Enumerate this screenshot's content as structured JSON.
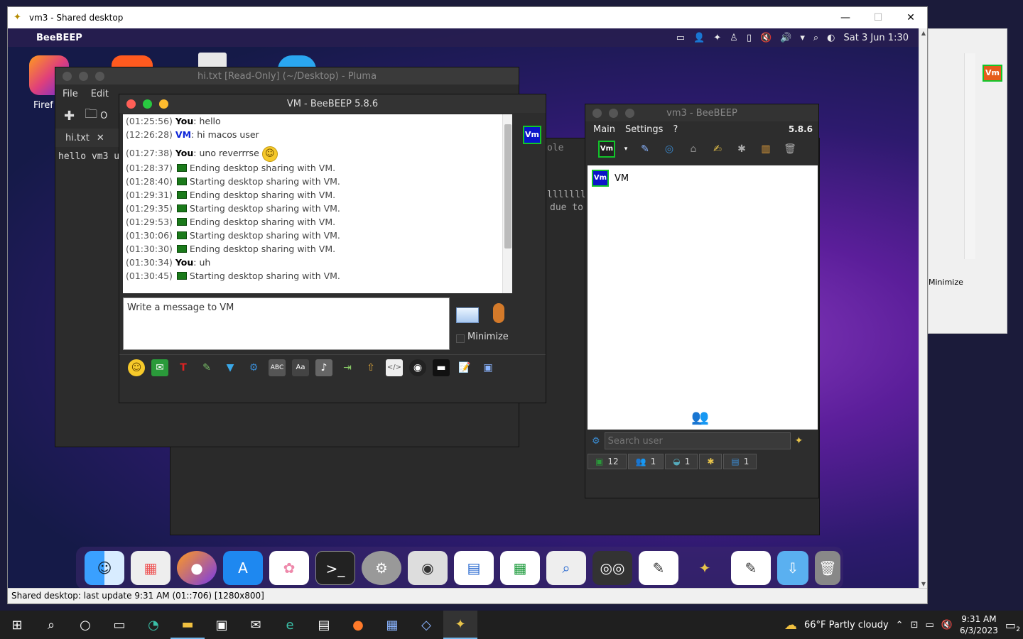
{
  "host": {
    "title": "vm3 - Shared desktop",
    "status": "Shared desktop: last update 9:31 AM (01::706) [1280x800]",
    "controls": {
      "minimize": "—",
      "maximize": "☐",
      "close": "✕"
    }
  },
  "mac_bar": {
    "app_name": "BeeBEEP",
    "datetime": "Sat 3 Jun 1:30"
  },
  "desktop": {
    "firefox_label": "Firef"
  },
  "pluma": {
    "title": "hi.txt [Read-Only] (~/Desktop) - Pluma",
    "menu": [
      "File",
      "Edit"
    ],
    "tab": "hi.txt",
    "text": "hello vm3 u",
    "toolbar_partial": "O"
  },
  "darkwin": {
    "line1": "ole",
    "line2": "lllllll",
    "line3": "due to"
  },
  "chat": {
    "title": "VM - BeeBEEP 5.8.6",
    "side_badge": "Vm",
    "messages": [
      {
        "time": "(01:25:56)",
        "sender": "You",
        "kind": "you",
        "text": " hello"
      },
      {
        "time": "(12:26:28)",
        "sender": "VM",
        "kind": "vm",
        "text": " hi macos user"
      },
      {
        "time": "(01:27:38)",
        "sender": "You",
        "kind": "you",
        "text": " uno reverrrse"
      },
      {
        "time": "(01:28:37)",
        "kind": "sys",
        "text": "Ending desktop sharing with VM."
      },
      {
        "time": "(01:28:40)",
        "kind": "sys",
        "text": "Starting desktop sharing with VM."
      },
      {
        "time": "(01:29:31)",
        "kind": "sys",
        "text": "Ending desktop sharing with VM."
      },
      {
        "time": "(01:29:35)",
        "kind": "sys",
        "text": "Starting desktop sharing with VM."
      },
      {
        "time": "(01:29:53)",
        "kind": "sys",
        "text": "Ending desktop sharing with VM."
      },
      {
        "time": "(01:30:06)",
        "kind": "sys",
        "text": "Starting desktop sharing with VM."
      },
      {
        "time": "(01:30:30)",
        "kind": "sys",
        "text": "Ending desktop sharing with VM."
      },
      {
        "time": "(01:30:34)",
        "sender": "You",
        "kind": "you",
        "text": " uh"
      },
      {
        "time": "(01:30:45)",
        "kind": "sys",
        "text": "Starting desktop sharing with VM."
      }
    ],
    "input_placeholder": "Write a message to VM",
    "minimize_label": "Minimize"
  },
  "bee": {
    "title": "vm3 - BeeBEEP",
    "menu": [
      "Main",
      "Settings",
      "?"
    ],
    "version": "5.8.6",
    "user_badge": "Vm",
    "user_name": "VM",
    "search_placeholder": "Search user",
    "tabs": [
      {
        "icon": "chat-icon",
        "count": "12"
      },
      {
        "icon": "users-icon",
        "count": "1"
      },
      {
        "icon": "groups-icon",
        "count": "1"
      },
      {
        "icon": "network-icon",
        "count": ""
      },
      {
        "icon": "files-icon",
        "count": "1"
      }
    ]
  },
  "rightwin": {
    "badge": "Vm",
    "minimize_label": "Minimize"
  },
  "taskbar": {
    "weather": "66°F  Partly cloudy",
    "time": "9:31 AM",
    "date": "6/3/2023",
    "notif_count": "2"
  }
}
